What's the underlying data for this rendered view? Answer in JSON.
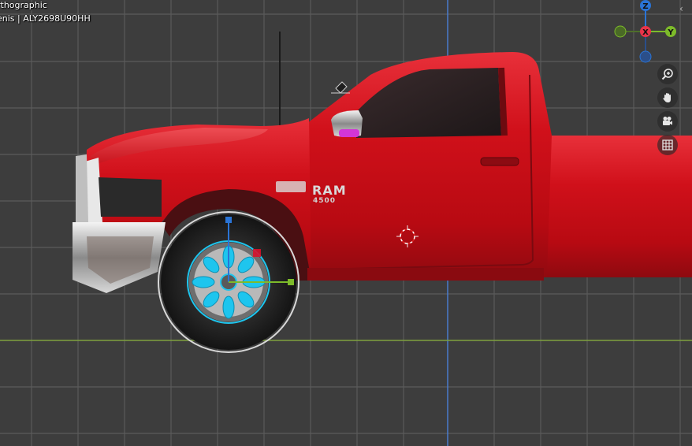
{
  "viewport": {
    "view_label": "rthographic",
    "collection_label": "enis | ALY2698U90HH",
    "background": "#3d3d3d",
    "grid_color": "#5b5b5b",
    "axis_x_color": "#7fa03f",
    "axis_z_color": "#4a7fd6"
  },
  "vehicle": {
    "paint_color": "#d0101a",
    "badge_text": "RAM",
    "badge_model": "4500"
  },
  "gizmo": {
    "z_label": "Z",
    "x_label": "X",
    "y_label": "Y",
    "z_color": "#2a74d6",
    "x_color": "#e8344a",
    "y_color": "#7dbb2a"
  },
  "nav_tools": [
    "zoom-icon",
    "pan-hand-icon",
    "camera-icon",
    "grid-ortho-icon"
  ]
}
